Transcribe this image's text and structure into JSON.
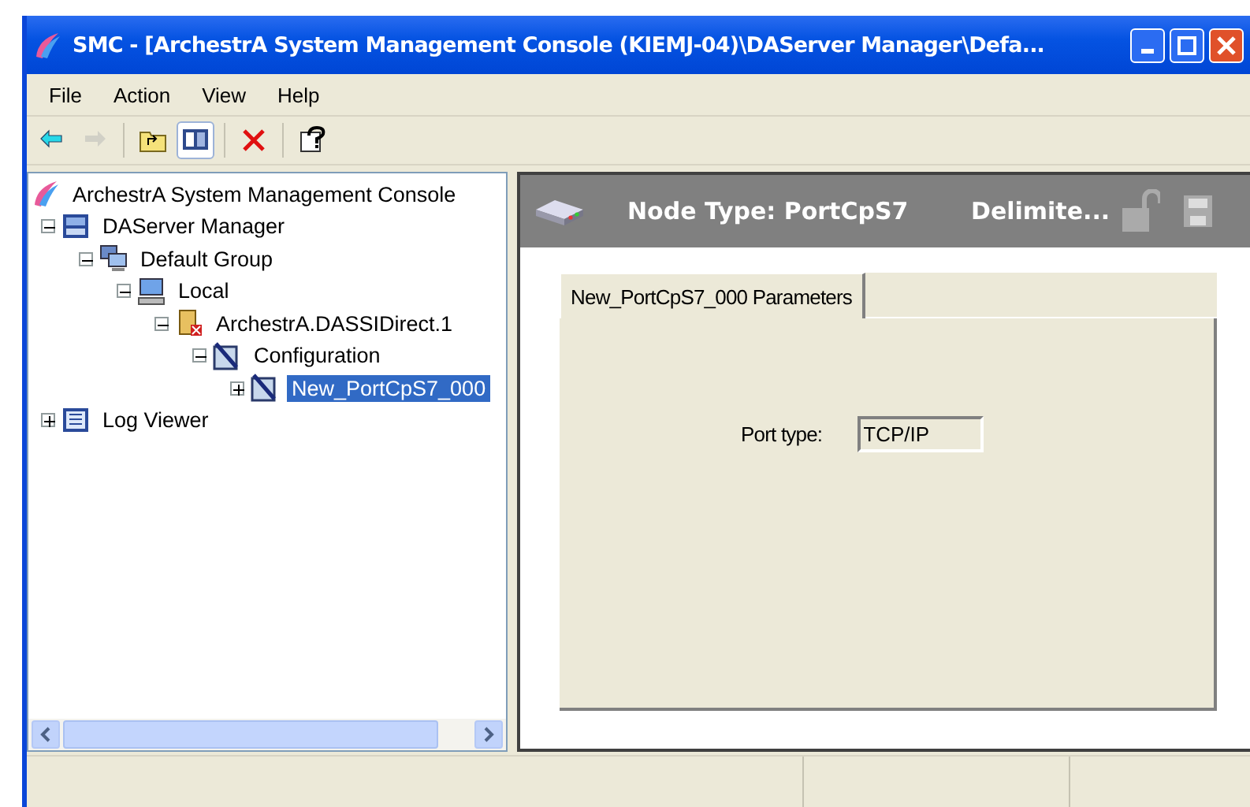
{
  "window": {
    "title": "SMC - [ArchestrA System Management Console (KIEMJ-04)\\DAServer Manager\\Defa..."
  },
  "menu": [
    "File",
    "Action",
    "View",
    "Help"
  ],
  "toolbar": [
    {
      "kind": "back",
      "disabled": false,
      "pressed": false
    },
    {
      "kind": "forward",
      "disabled": true,
      "pressed": false
    },
    {
      "kind": "sep"
    },
    {
      "kind": "up",
      "disabled": false,
      "pressed": false
    },
    {
      "kind": "tree",
      "disabled": false,
      "pressed": true
    },
    {
      "kind": "sep"
    },
    {
      "kind": "delete",
      "disabled": false,
      "pressed": false
    },
    {
      "kind": "sep"
    },
    {
      "kind": "help",
      "disabled": false,
      "pressed": false
    }
  ],
  "tree": {
    "label": "ArchestrA System Management Console",
    "kind": "console",
    "selected": false,
    "children": [
      {
        "label": "DAServer Manager",
        "kind": "manager",
        "expanded": true,
        "selected": false,
        "children": [
          {
            "label": "Default Group",
            "kind": "group",
            "expanded": true,
            "selected": false,
            "children": [
              {
                "label": "Local",
                "kind": "computer",
                "expanded": true,
                "selected": false,
                "children": [
                  {
                    "label": "ArchestrA.DASSIDirect.1",
                    "kind": "server",
                    "expanded": true,
                    "selected": false,
                    "children": [
                      {
                        "label": "Configuration",
                        "kind": "config",
                        "expanded": true,
                        "selected": false,
                        "children": [
                          {
                            "label": "New_PortCpS7_000",
                            "kind": "config",
                            "expanded": false,
                            "selected": true
                          }
                        ]
                      }
                    ]
                  }
                ]
              }
            ]
          }
        ]
      },
      {
        "label": "Log Viewer",
        "kind": "log",
        "expanded": false,
        "selected": false
      }
    ]
  },
  "details": {
    "title": "Node Type: PortCpS7",
    "subtitle": "Delimite...",
    "tabs": [
      {
        "label": "New_PortCpS7_000 Parameters",
        "selected": true
      }
    ],
    "fields": [
      {
        "label": "Port type:",
        "value": "TCP/IP",
        "disabled": true
      }
    ]
  }
}
